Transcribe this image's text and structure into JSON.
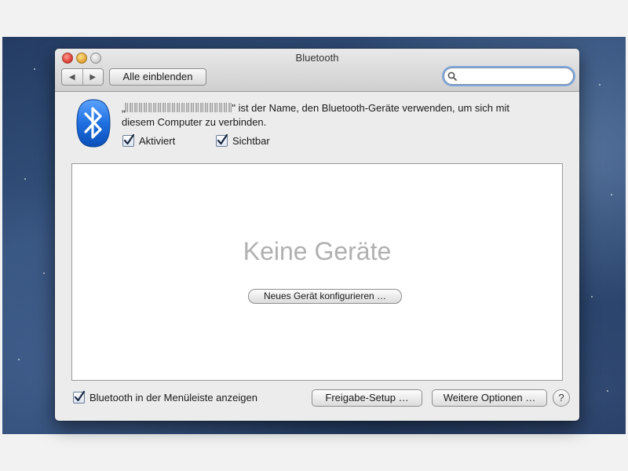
{
  "window": {
    "title": "Bluetooth"
  },
  "toolbar": {
    "back_icon": "◀",
    "forward_icon": "▶",
    "show_all_label": "Alle einblenden",
    "search_value": "",
    "search_placeholder": ""
  },
  "header": {
    "quote_open": "„",
    "device_name_redacted": "",
    "description_line1": "\" ist der Name, den Bluetooth-Geräte verwenden, um sich mit",
    "description_line2": "diesem Computer zu verbinden.",
    "checkbox_activated": {
      "label": "Aktiviert",
      "checked": true
    },
    "checkbox_visible": {
      "label": "Sichtbar",
      "checked": true
    }
  },
  "devices": {
    "empty_text": "Keine Geräte",
    "new_device_button": "Neues Gerät konfigurieren …"
  },
  "footer": {
    "menubar_checkbox": {
      "label": "Bluetooth in der Menüleiste anzeigen",
      "checked": true
    },
    "sharing_setup_button": "Freigabe-Setup …",
    "more_options_button": "Weitere Optionen …",
    "help_button": "?"
  },
  "colors": {
    "bluetooth_blue": "#1f6fe0",
    "search_focus_ring": "#6ea0e1"
  }
}
